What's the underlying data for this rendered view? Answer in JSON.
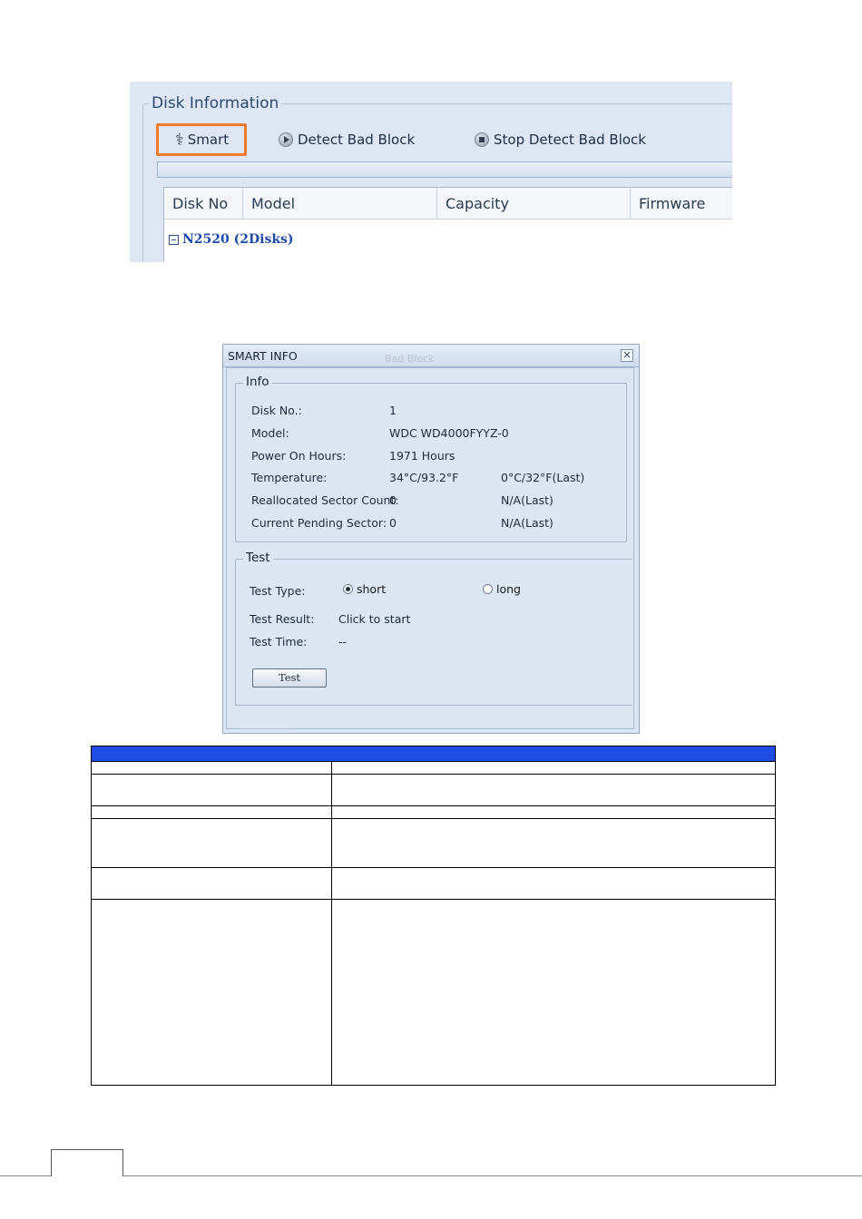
{
  "disk_panel": {
    "title": "Disk Information",
    "toolbar": {
      "smart_label": "Smart",
      "detect_label": "Detect Bad Block",
      "stop_label": "Stop Detect Bad Block"
    },
    "columns": [
      "Disk No",
      "Model",
      "Capacity",
      "Firmware"
    ],
    "group_label": "N2520 (2Disks)",
    "highlight_color": "#f0792b"
  },
  "smart_dialog": {
    "title": "SMART INFO",
    "ghost_text": "Bad Block",
    "close_glyph": "✕",
    "info": {
      "legend": "Info",
      "rows": [
        {
          "label": "Disk No.:",
          "value": "1",
          "last": ""
        },
        {
          "label": "Model:",
          "value": "WDC WD4000FYYZ-0",
          "last": ""
        },
        {
          "label": "Power On Hours:",
          "value": "1971 Hours",
          "last": ""
        },
        {
          "label": "Temperature:",
          "value": "34°C/93.2°F",
          "last": "0°C/32°F(Last)"
        },
        {
          "label": "Reallocated Sector Count:",
          "value": "0",
          "last": "N/A(Last)"
        },
        {
          "label": "Current Pending Sector:",
          "value": "0",
          "last": "N/A(Last)"
        }
      ]
    },
    "test": {
      "legend": "Test",
      "type_label": "Test Type:",
      "option_short": "short",
      "option_long": "long",
      "selected": "short",
      "result_label": "Test Result:",
      "result_value": "Click to start",
      "time_label": "Test Time:",
      "time_value": "--",
      "button_label": "Test"
    }
  },
  "table": {
    "header_color": "#1f4ce6"
  }
}
